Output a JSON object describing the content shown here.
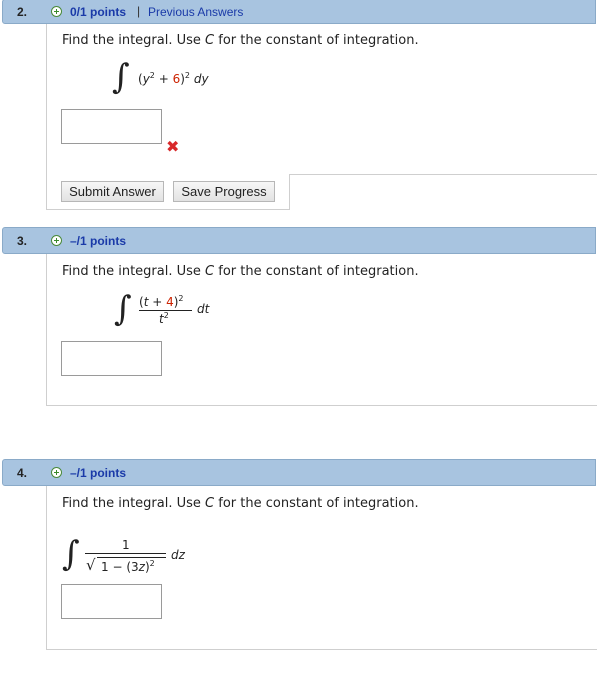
{
  "questions": [
    {
      "number": "2.",
      "points": "0/1 points",
      "separator": "|",
      "link": "Previous Answers",
      "prompt_before": "Find the integral. Use ",
      "prompt_var": "C",
      "prompt_after": " for the constant of integration.",
      "integrand": {
        "base_var": "y",
        "exp_inner": "2",
        "plus": " + ",
        "const": "6",
        "exp_outer": "2",
        "diff": "dy"
      },
      "answer_value": "",
      "result_icon": "incorrect-x-icon",
      "buttons": {
        "submit": "Submit Answer",
        "save": "Save Progress"
      }
    },
    {
      "number": "3.",
      "points": "–/1 points",
      "prompt_before": "Find the integral. Use ",
      "prompt_var": "C",
      "prompt_after": " for the constant of integration.",
      "integrand": {
        "num_var": "t",
        "plus": " + ",
        "const": "4",
        "num_exp": "2",
        "den_var": "t",
        "den_exp": "2",
        "diff": "dt"
      },
      "answer_value": ""
    },
    {
      "number": "4.",
      "points": "–/1 points",
      "prompt_before": "Find the integral. Use ",
      "prompt_var": "C",
      "prompt_after": " for the constant of integration.",
      "integrand": {
        "numerator": "1",
        "den_text": "1 − (3",
        "den_var": "z",
        "den_close": ")",
        "den_exp": "2",
        "diff": "dz"
      },
      "answer_value": ""
    }
  ],
  "colors": {
    "header_bg": "#a8c4e0",
    "points_text": "#1a3aa8",
    "incorrect": "#d8282a",
    "highlight_const": "#cc2200"
  }
}
